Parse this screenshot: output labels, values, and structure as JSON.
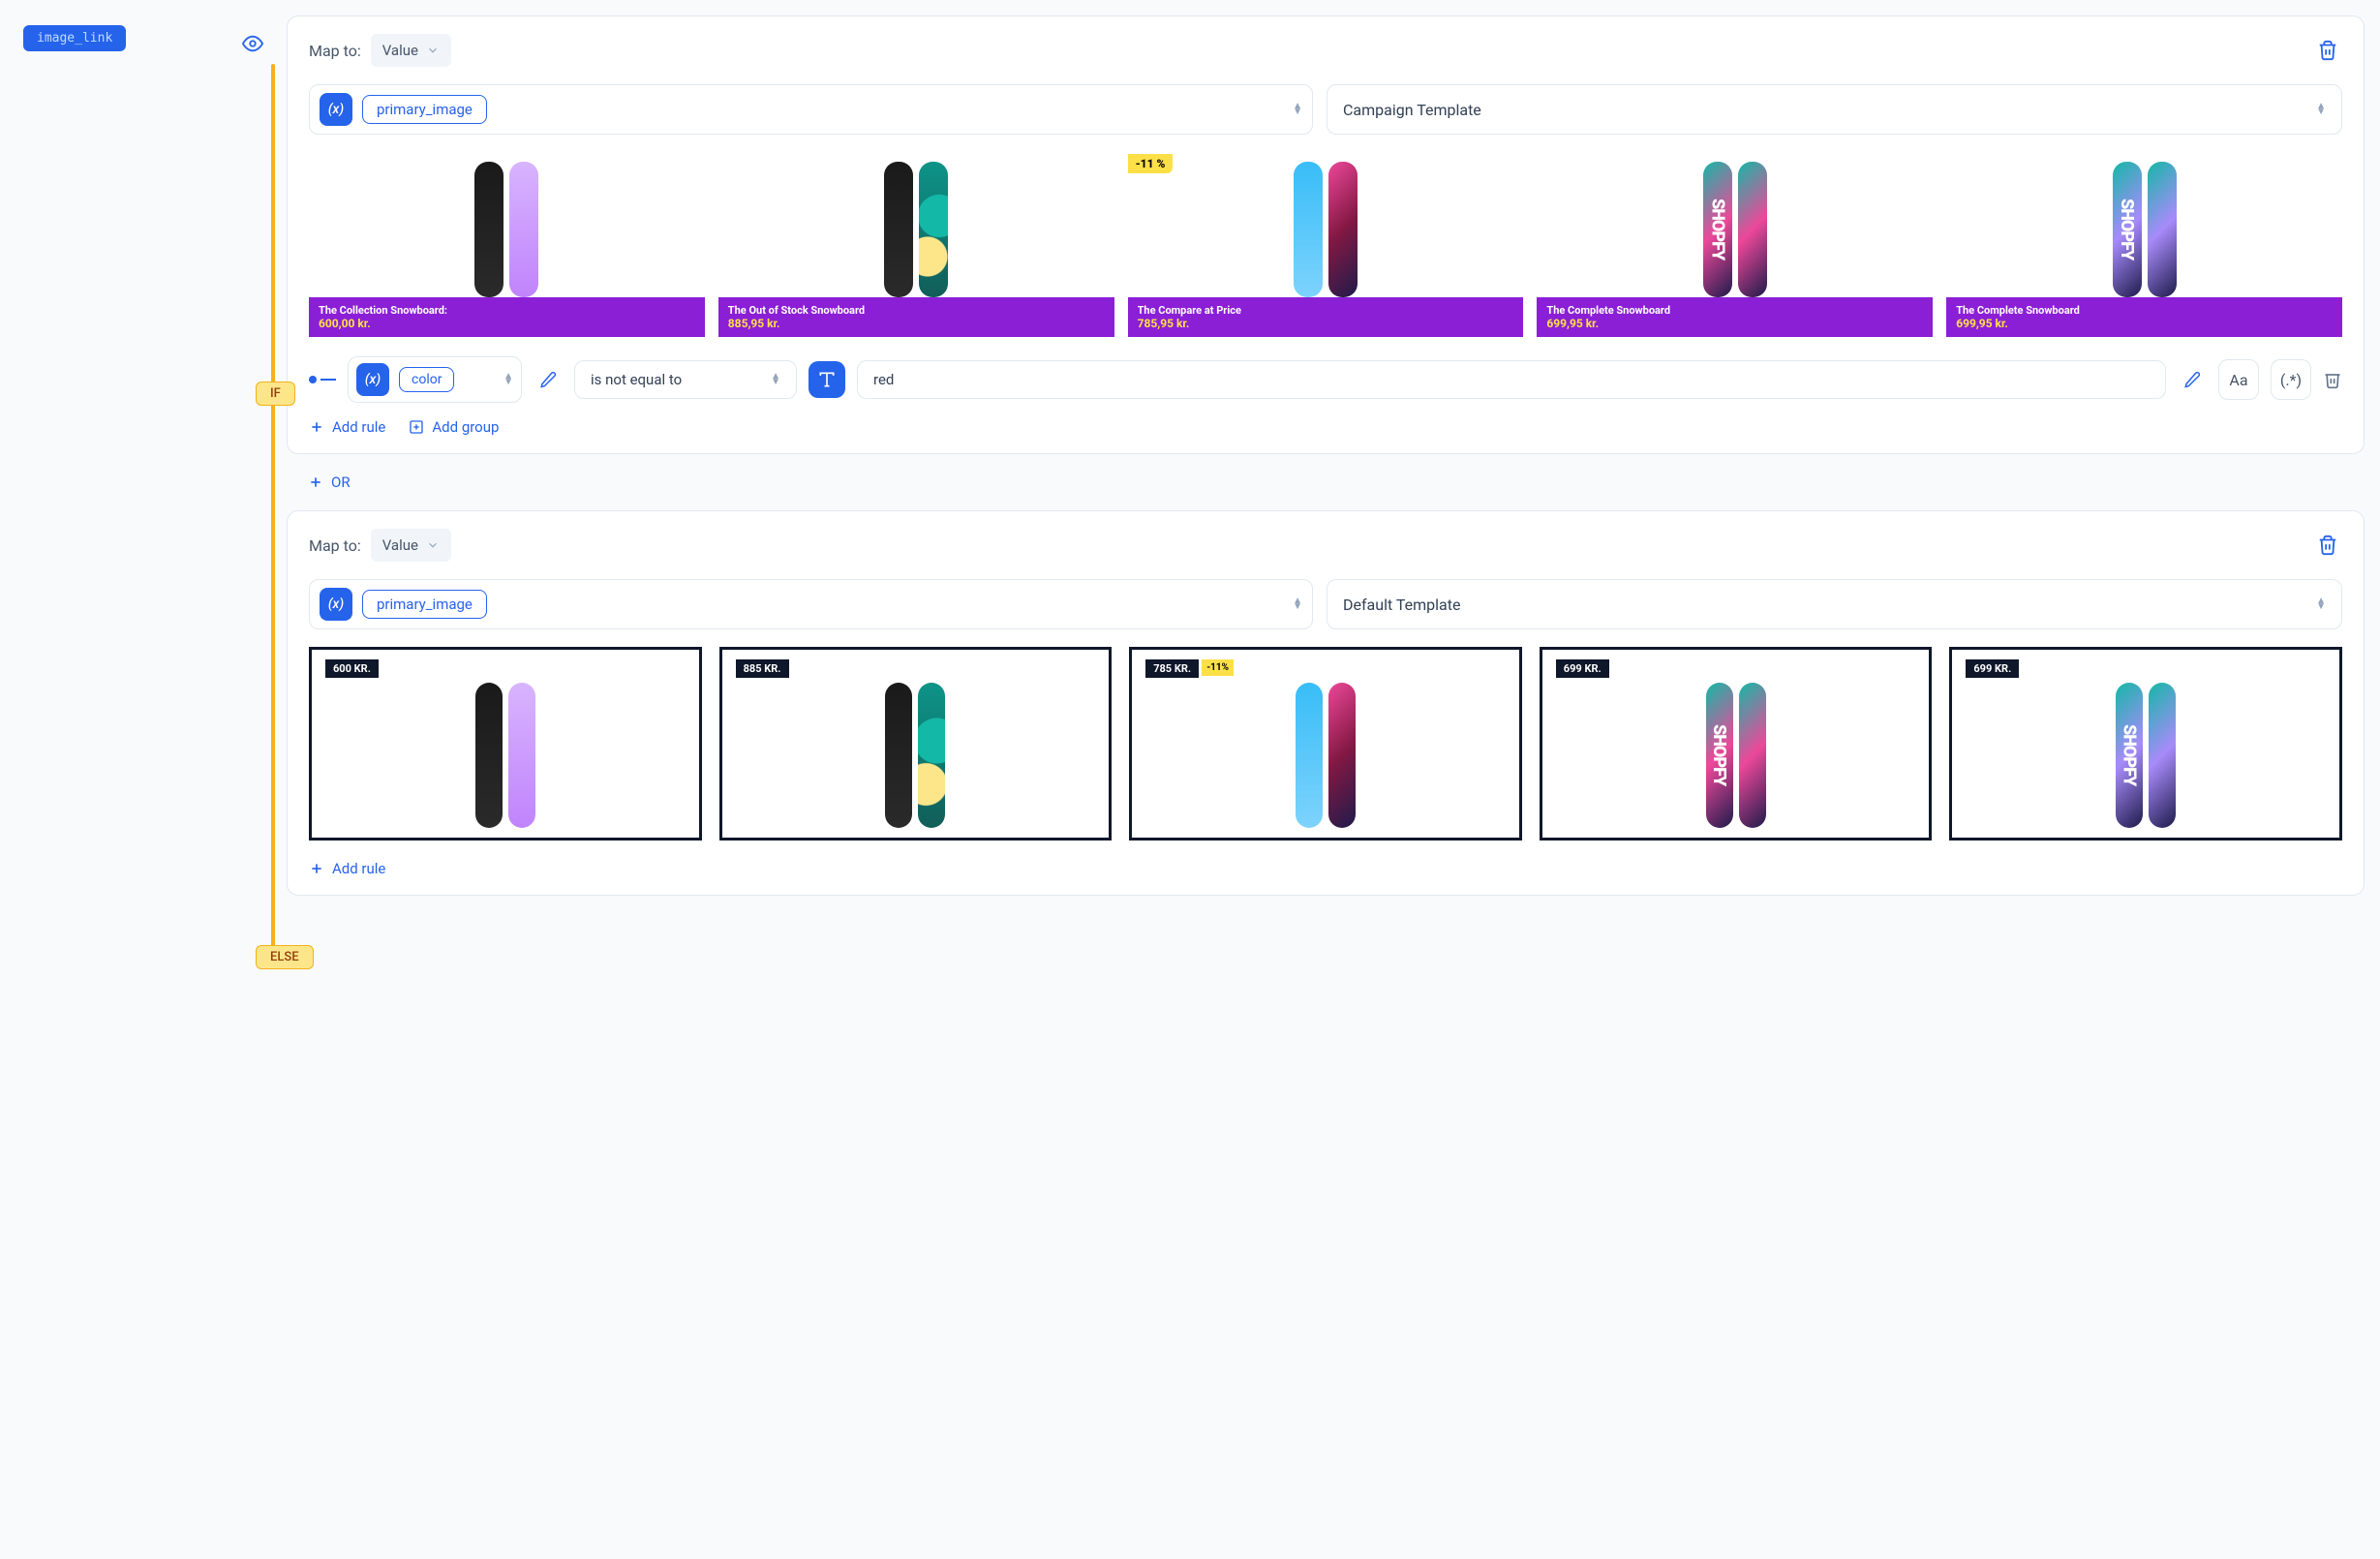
{
  "tag": "image_link",
  "if_label": "IF",
  "else_label": "ELSE",
  "or_label": "OR",
  "block1": {
    "map_to_label": "Map to:",
    "map_to_value": "Value",
    "field": "primary_image",
    "template": "Campaign Template",
    "products": [
      {
        "title": "The Collection Snowboard:",
        "price": "600,00 kr.",
        "discount": null
      },
      {
        "title": "The Out of Stock Snowboard",
        "price": "885,95 kr.",
        "discount": null
      },
      {
        "title": "The Compare at Price",
        "price": "785,95 kr.",
        "discount": "-11 %"
      },
      {
        "title": "The Complete Snowboard",
        "price": "699,95 kr.",
        "discount": null
      },
      {
        "title": "The Complete Snowboard",
        "price": "699,95 kr.",
        "discount": null
      }
    ],
    "rule": {
      "field": "color",
      "operator": "is not equal to",
      "value": "red",
      "case_btn": "Aa",
      "regex_btn": "(.*)"
    },
    "add_rule": "Add rule",
    "add_group": "Add group"
  },
  "block2": {
    "map_to_label": "Map to:",
    "map_to_value": "Value",
    "field": "primary_image",
    "template": "Default Template",
    "products": [
      {
        "price_badge": "600 KR.",
        "discount": null
      },
      {
        "price_badge": "885 KR.",
        "discount": null
      },
      {
        "price_badge": "785 KR.",
        "discount": "-11%"
      },
      {
        "price_badge": "699 KR.",
        "discount": null
      },
      {
        "price_badge": "699 KR.",
        "discount": null
      }
    ],
    "add_rule": "Add rule"
  }
}
